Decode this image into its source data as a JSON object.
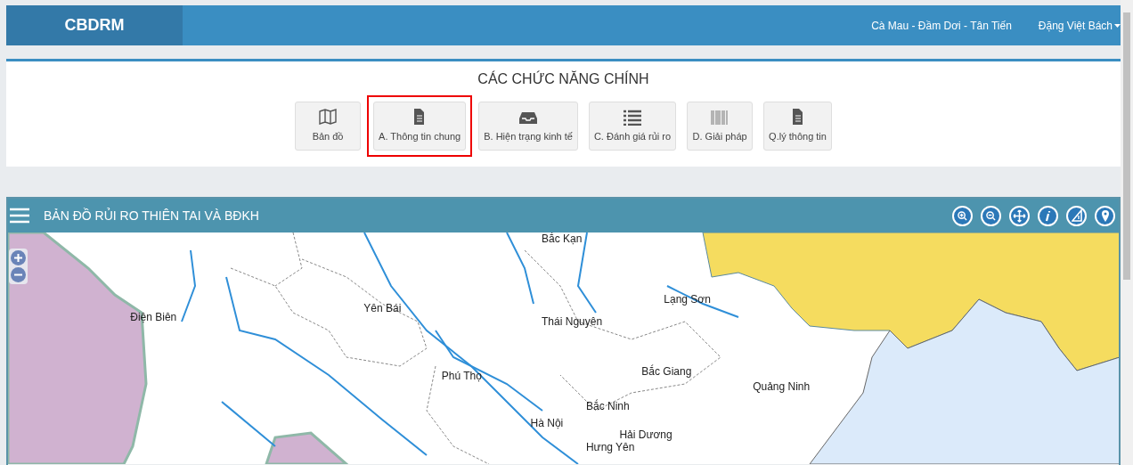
{
  "navbar": {
    "brand": "CBDRM",
    "location": "Cà Mau - Đầm Dơi - Tân Tiến",
    "user": "Đặng Việt Bách"
  },
  "functions": {
    "title": "CÁC CHỨC NĂNG CHÍNH",
    "buttons": [
      {
        "kind": "map",
        "label": "Bản đồ",
        "highlighted": false
      },
      {
        "kind": "document",
        "label": "A. Thông tin chung",
        "highlighted": true
      },
      {
        "kind": "inbox",
        "label": "B. Hiện trạng kinh tế",
        "highlighted": false
      },
      {
        "kind": "list",
        "label": "C. Đánh giá rủi ro",
        "highlighted": false
      },
      {
        "kind": "barcode",
        "label": "D. Giải pháp",
        "highlighted": false
      },
      {
        "kind": "document",
        "label": "Q.lý thông tin",
        "highlighted": false
      }
    ]
  },
  "map": {
    "title": "BẢN ĐỒ RỦI RO THIÊN TAI VÀ BĐKH",
    "places": [
      "Bắc Kạn",
      "Điện Biên",
      "Yên Bái",
      "Lạng Sơn",
      "Thái Nguyên",
      "Phú Thọ",
      "Bắc Giang",
      "Quảng Ninh",
      "Bắc Ninh",
      "Hà Nội",
      "Hải Dương",
      "Hưng Yên"
    ]
  }
}
